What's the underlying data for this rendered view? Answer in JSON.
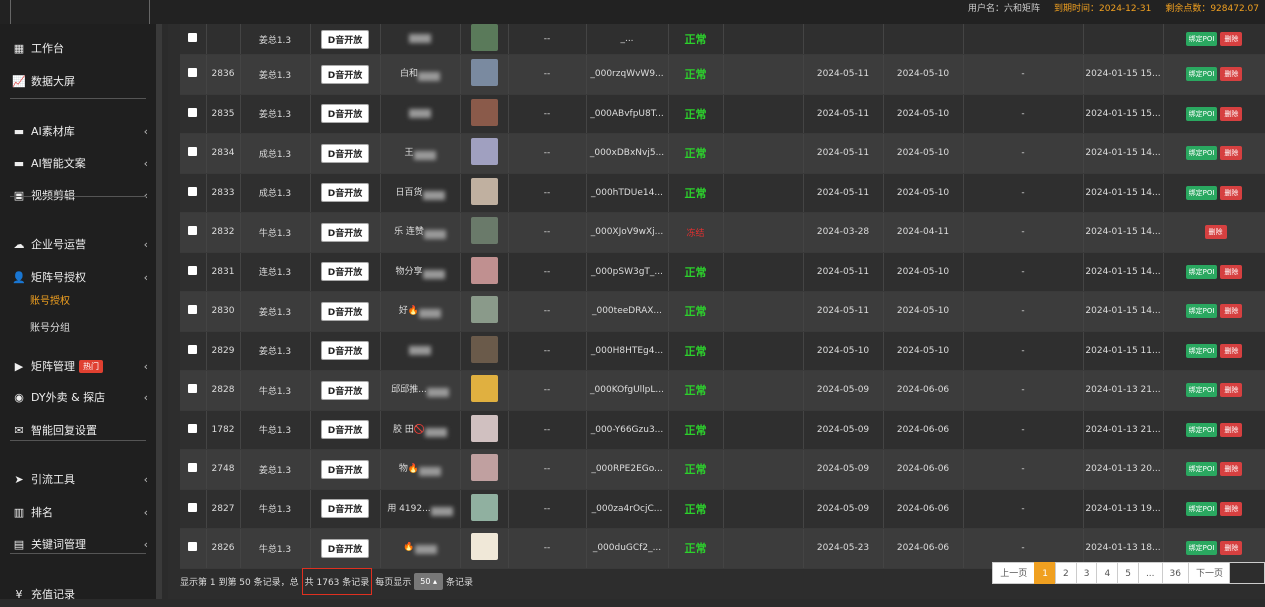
{
  "topbar": {
    "user": "用户名：六和矩阵",
    "expiry": "到期时间：2024-12-31",
    "points": "剩余点数：928472.07"
  },
  "sidebar": {
    "items": [
      {
        "label": "工作台",
        "icon": "desktop-icon",
        "glyph": "▦",
        "chev": false
      },
      {
        "label": "数据大屏",
        "icon": "chart-line-icon",
        "glyph": "📈",
        "chev": false
      },
      {
        "label": "AI素材库",
        "icon": "folder-icon",
        "glyph": "▬",
        "chev": true
      },
      {
        "label": "AI智能文案",
        "icon": "folder-icon",
        "glyph": "▬",
        "chev": true
      },
      {
        "label": "视频剪辑",
        "icon": "film-icon",
        "glyph": "▣",
        "chev": true
      },
      {
        "label": "企业号运营",
        "icon": "cloud-icon",
        "glyph": "☁",
        "chev": true
      },
      {
        "label": "矩阵号授权",
        "icon": "user-icon",
        "glyph": "👤",
        "chev": true
      },
      {
        "label": "矩阵管理",
        "icon": "video-icon",
        "glyph": "▶",
        "chev": true,
        "badge": "热门"
      },
      {
        "label": "DY外卖 & 探店",
        "icon": "globe-icon",
        "glyph": "◉",
        "chev": true
      },
      {
        "label": "智能回复设置",
        "icon": "envelope-icon",
        "glyph": "✉",
        "chev": false
      },
      {
        "label": "引流工具",
        "icon": "paper-plane-icon",
        "glyph": "➤",
        "chev": true
      },
      {
        "label": "排名",
        "icon": "ranking-icon",
        "glyph": "▥",
        "chev": true
      },
      {
        "label": "关键词管理",
        "icon": "file-icon",
        "glyph": "▤",
        "chev": true
      },
      {
        "label": "充值记录",
        "icon": "yen-icon",
        "glyph": "¥",
        "chev": false
      }
    ],
    "subitems": [
      {
        "label": "账号授权",
        "active": true
      },
      {
        "label": "账号分组",
        "active": false
      }
    ]
  },
  "table": {
    "dbtn_label": "D音开放",
    "poi_label": "绑定POI",
    "del_label": "删除",
    "rows": [
      {
        "id": "",
        "owner": "姜总1.3",
        "nick": "",
        "openid": "_...",
        "status": "正常",
        "d1": "",
        "d2": "",
        "dash": "",
        "created": "",
        "avatar": "#5a7a5a",
        "poi": true,
        "partial": true
      },
      {
        "id": "2836",
        "owner": "姜总1.3",
        "nick": "白和",
        "openid": "_000rzqWvW9...",
        "status": "正常",
        "d1": "2024-05-11",
        "d2": "2024-05-10",
        "dash": "-",
        "created": "2024-01-15 15...",
        "avatar": "#7a8aa0",
        "poi": true
      },
      {
        "id": "2835",
        "owner": "姜总1.3",
        "nick": "",
        "openid": "_000ABvfpU8T...",
        "status": "正常",
        "d1": "2024-05-11",
        "d2": "2024-05-10",
        "dash": "-",
        "created": "2024-01-15 15...",
        "avatar": "#8a5a4a",
        "poi": true
      },
      {
        "id": "2834",
        "owner": "成总1.3",
        "nick": "王",
        "openid": "_000xDBxNvj5...",
        "status": "正常",
        "d1": "2024-05-11",
        "d2": "2024-05-10",
        "dash": "-",
        "created": "2024-01-15 14...",
        "avatar": "#a0a0c0",
        "poi": true
      },
      {
        "id": "2833",
        "owner": "成总1.3",
        "nick": "日百货",
        "openid": "_000hTDUe14...",
        "status": "正常",
        "d1": "2024-05-11",
        "d2": "2024-05-10",
        "dash": "-",
        "created": "2024-01-15 14...",
        "avatar": "#c0b0a0",
        "poi": true
      },
      {
        "id": "2832",
        "owner": "牛总1.3",
        "nick": "乐 连赞",
        "openid": "_000XJoV9wXj...",
        "status": "冻结",
        "d1": "2024-03-28",
        "d2": "2024-04-11",
        "dash": "-",
        "created": "2024-01-15 14...",
        "avatar": "#6a7a6a",
        "poi": false
      },
      {
        "id": "2831",
        "owner": "连总1.3",
        "nick": "物分享",
        "openid": "_000pSW3gT_...",
        "status": "正常",
        "d1": "2024-05-11",
        "d2": "2024-05-10",
        "dash": "-",
        "created": "2024-01-15 14...",
        "avatar": "#c09090",
        "poi": true
      },
      {
        "id": "2830",
        "owner": "姜总1.3",
        "nick": "好🔥",
        "openid": "_000teeDRAX...",
        "status": "正常",
        "d1": "2024-05-11",
        "d2": "2024-05-10",
        "dash": "-",
        "created": "2024-01-15 14...",
        "avatar": "#8a9a8a",
        "poi": true
      },
      {
        "id": "2829",
        "owner": "姜总1.3",
        "nick": "",
        "openid": "_000H8HTEg4...",
        "status": "正常",
        "d1": "2024-05-10",
        "d2": "2024-05-10",
        "dash": "-",
        "created": "2024-01-15 11...",
        "avatar": "#6a5a4a",
        "poi": true
      },
      {
        "id": "2828",
        "owner": "牛总1.3",
        "nick": "邱邱推...",
        "openid": "_000KOfgUllpL...",
        "status": "正常",
        "d1": "2024-05-09",
        "d2": "2024-06-06",
        "dash": "-",
        "created": "2024-01-13 21...",
        "avatar": "#e0b040",
        "poi": true
      },
      {
        "id": "1782",
        "owner": "牛总1.3",
        "nick": "胶 田🚫",
        "openid": "_000-Y66Gzu3...",
        "status": "正常",
        "d1": "2024-05-09",
        "d2": "2024-06-06",
        "dash": "-",
        "created": "2024-01-13 21...",
        "avatar": "#d0c0c0",
        "poi": true
      },
      {
        "id": "2748",
        "owner": "姜总1.3",
        "nick": "物🔥",
        "openid": "_000RPE2EGo...",
        "status": "正常",
        "d1": "2024-05-09",
        "d2": "2024-06-06",
        "dash": "-",
        "created": "2024-01-13 20...",
        "avatar": "#c0a0a0",
        "poi": true
      },
      {
        "id": "2827",
        "owner": "牛总1.3",
        "nick": "用 4192...",
        "openid": "_000za4rOcjC...",
        "status": "正常",
        "d1": "2024-05-09",
        "d2": "2024-06-06",
        "dash": "-",
        "created": "2024-01-13 19...",
        "avatar": "#90b0a0",
        "poi": true
      },
      {
        "id": "2826",
        "owner": "牛总1.3",
        "nick": "🔥",
        "openid": "_000duGCf2_...",
        "status": "正常",
        "d1": "2024-05-23",
        "d2": "2024-06-06",
        "dash": "-",
        "created": "2024-01-13 18...",
        "avatar": "#f0e8d8",
        "poi": true
      }
    ]
  },
  "footer": {
    "info_prefix": "显示第 1 到第 50 条记录，总",
    "total": "共 1763 条记录",
    "per_page_label": "每页显示",
    "page_size": "50 ▴",
    "suffix": "条记录"
  },
  "pager": {
    "prev": "上一页",
    "pages": [
      "1",
      "2",
      "3",
      "4",
      "5",
      "...",
      "36"
    ],
    "next": "下一页"
  }
}
